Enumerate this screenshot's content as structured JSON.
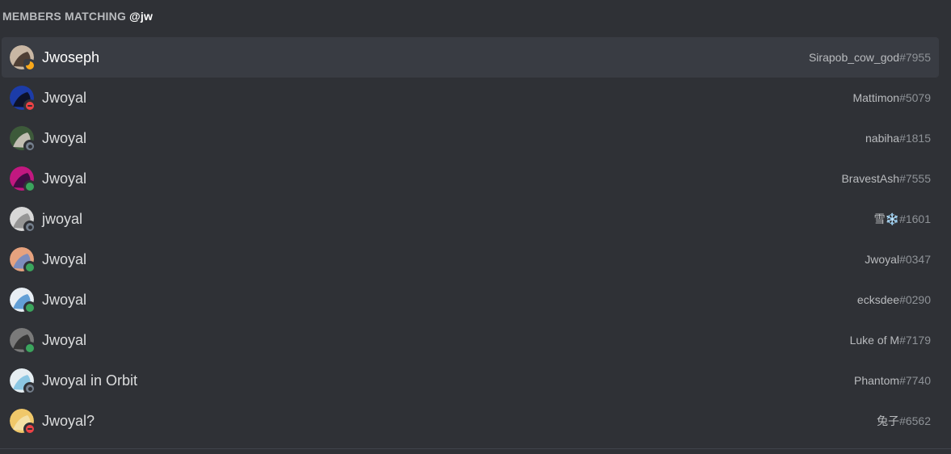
{
  "header": {
    "label": "MEMBERS MATCHING",
    "query": "@jw"
  },
  "members": [
    {
      "nickname": "Jwoseph",
      "username": "Sirapob_cow_god",
      "discriminator": "#7955",
      "status": "idle",
      "avatar_colors": [
        "#c9b7a4",
        "#3a2a22"
      ],
      "selected": true
    },
    {
      "nickname": "Jwoyal",
      "username": "Mattimon",
      "discriminator": "#5079",
      "status": "dnd",
      "avatar_colors": [
        "#1c3ca8",
        "#0a0a14"
      ],
      "selected": false
    },
    {
      "nickname": "Jwoyal",
      "username": "nabiha",
      "discriminator": "#1815",
      "status": "offline",
      "avatar_colors": [
        "#3d5a3a",
        "#d8d0c8"
      ],
      "selected": false
    },
    {
      "nickname": "Jwoyal",
      "username": "BravestAsh",
      "discriminator": "#7555",
      "status": "online",
      "avatar_colors": [
        "#c21880",
        "#2a0a3a"
      ],
      "selected": false
    },
    {
      "nickname": "jwoyal",
      "username": "雪❄️",
      "discriminator": "#1601",
      "status": "offline",
      "avatar_colors": [
        "#d8d8d8",
        "#8a8a8a"
      ],
      "selected": false
    },
    {
      "nickname": "Jwoyal",
      "username": "Jwoyal",
      "discriminator": "#0347",
      "status": "online",
      "avatar_colors": [
        "#e6a27e",
        "#6a8ac8"
      ],
      "selected": false
    },
    {
      "nickname": "Jwoyal",
      "username": "ecksdee",
      "discriminator": "#0290",
      "status": "online",
      "avatar_colors": [
        "#e8eef4",
        "#4a90d0"
      ],
      "selected": false
    },
    {
      "nickname": "Jwoyal",
      "username": "Luke of M",
      "discriminator": "#7179",
      "status": "online",
      "avatar_colors": [
        "#7a7a7a",
        "#2a2a2a"
      ],
      "selected": false
    },
    {
      "nickname": "Jwoyal in Orbit",
      "username": "Phantom",
      "discriminator": "#7740",
      "status": "offline",
      "avatar_colors": [
        "#e6eef2",
        "#7ac0e0"
      ],
      "selected": false
    },
    {
      "nickname": "Jwoyal?",
      "username": "兔子",
      "discriminator": "#6562",
      "status": "dnd",
      "avatar_colors": [
        "#f0c86a",
        "#f4e4b0"
      ],
      "selected": false
    }
  ]
}
